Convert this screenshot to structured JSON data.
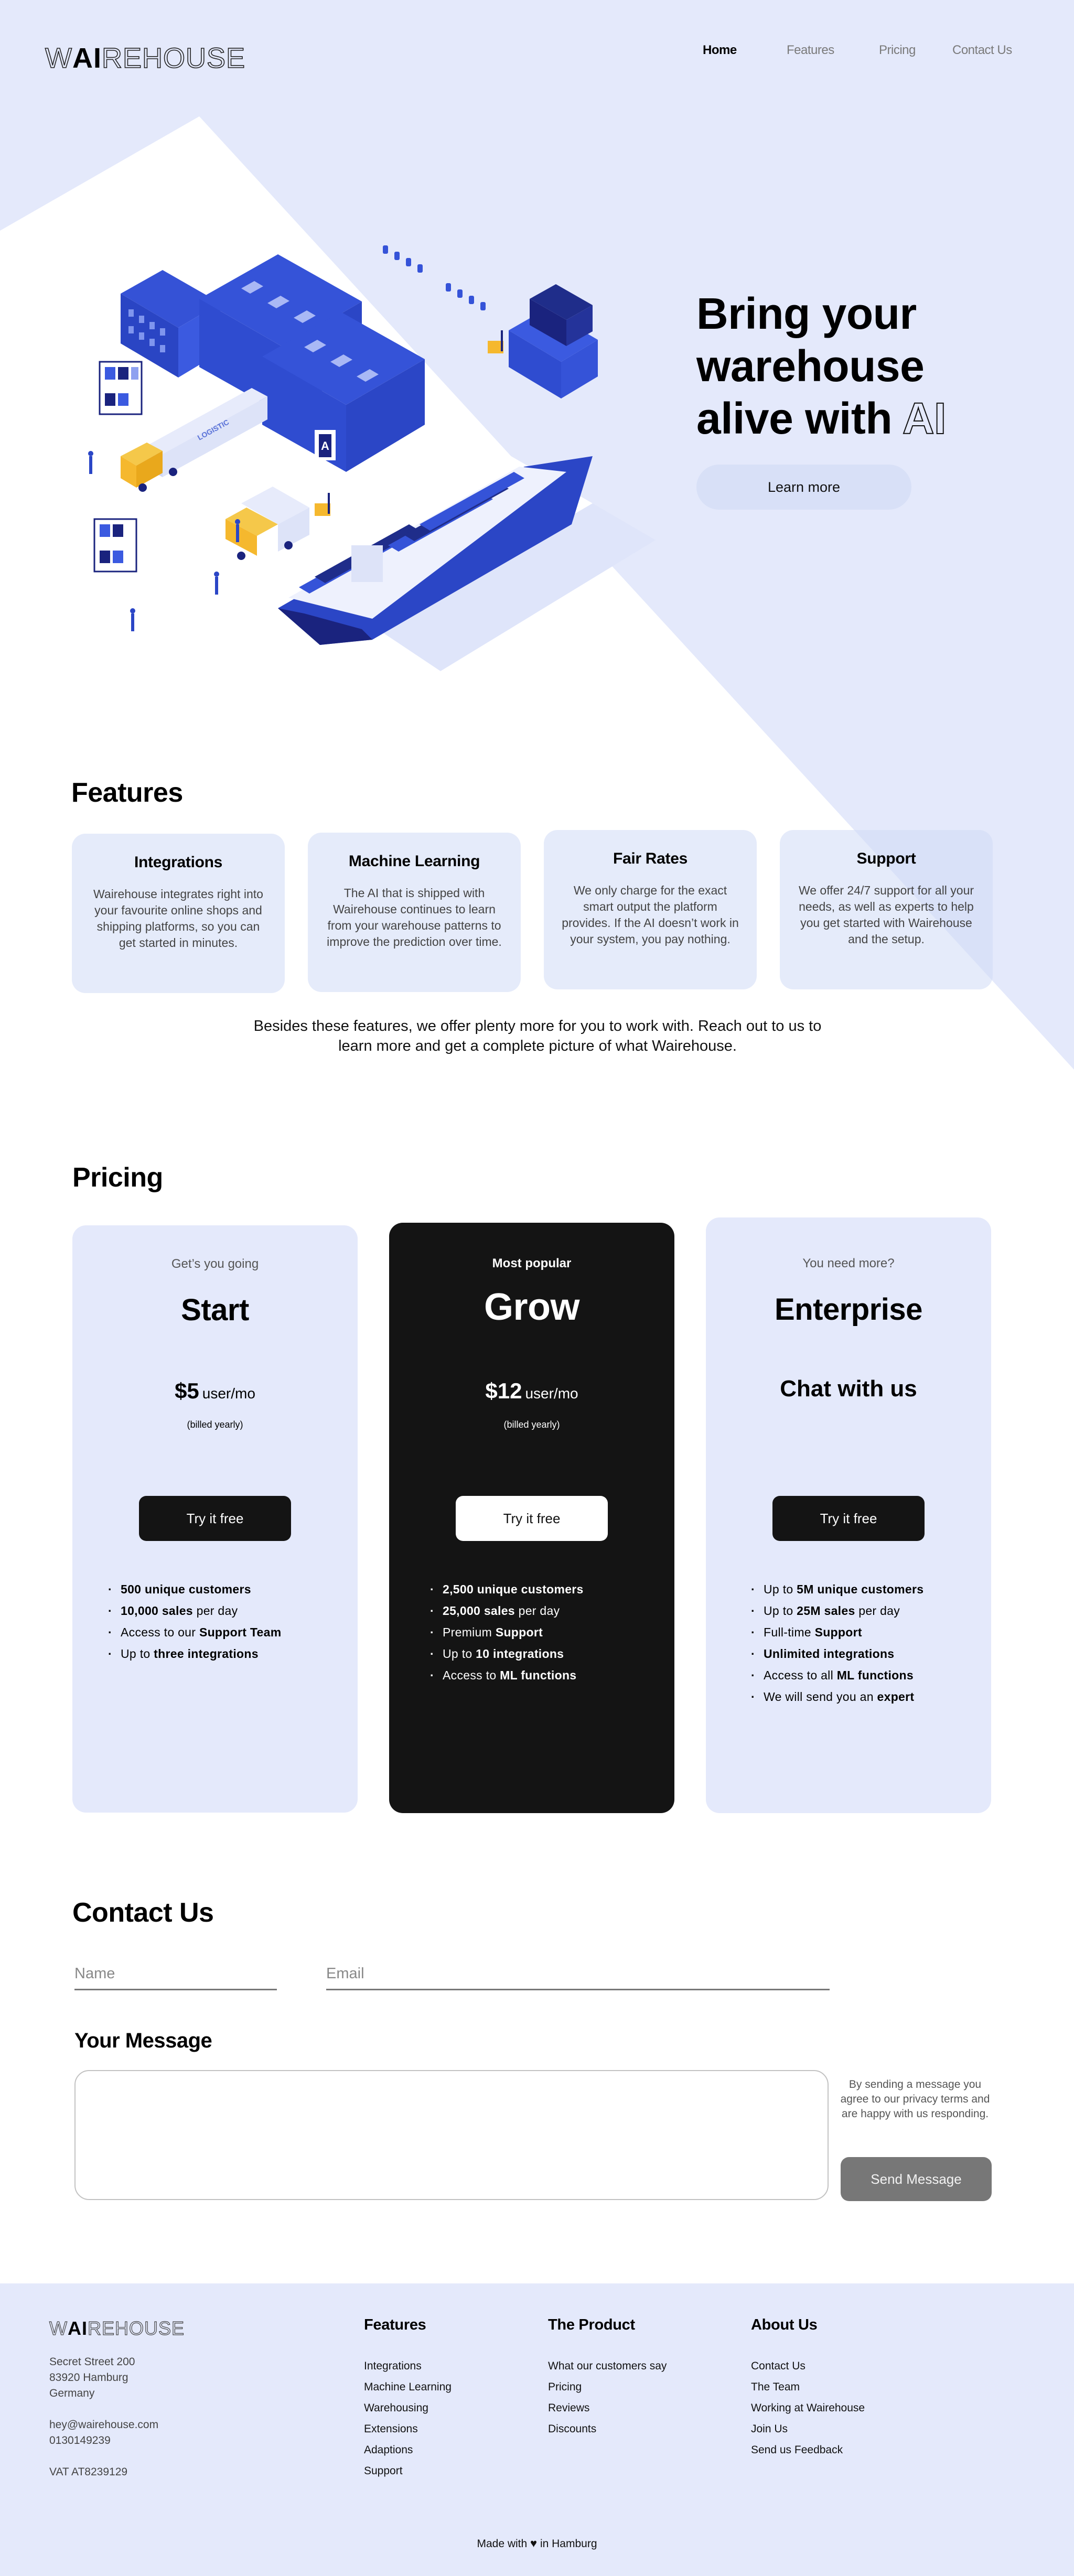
{
  "colors": {
    "background_tint": "#e4e9fb",
    "card_light": "#e4e9fb",
    "card_dark": "#141414",
    "learn_more_bg": "#d8e0f7",
    "illustration_blue": "#2f4fd0",
    "illustration_navy": "#1a237e",
    "illustration_yellow": "#f5b82e",
    "send_button": "#777777"
  },
  "header": {
    "logo": {
      "prefix": "W",
      "highlight": "AI",
      "suffix": "REHOUSE"
    },
    "nav": [
      {
        "label": "Home",
        "active": true
      },
      {
        "label": "Features",
        "active": false
      },
      {
        "label": "Pricing",
        "active": false
      },
      {
        "label": "Contact Us",
        "active": false
      }
    ]
  },
  "hero": {
    "title_line1": "Bring your",
    "title_line2": "warehouse",
    "title_line3_prefix": "alive with ",
    "title_line3_outline": "AI",
    "cta_label": "Learn more",
    "illustration": {
      "semantic": "isometric-warehouse-logistics-illustration",
      "truck_label": "LOGISTIC",
      "building_sign": "A"
    }
  },
  "features": {
    "title": "Features",
    "cards": [
      {
        "title": "Integrations",
        "text": "Wairehouse integrates right into your favourite online shops and shipping platforms, so you can get started in minutes."
      },
      {
        "title": "Machine Learning",
        "text": "The AI that is shipped with Wairehouse continues to learn from your warehouse patterns to improve the prediction over time."
      },
      {
        "title": "Fair Rates",
        "text": "We only charge for the exact smart output the platform provides. If the AI doesn’t work in your system, you pay nothing."
      },
      {
        "title": "Support",
        "text": "We offer 24/7 support for all your needs, as well as experts to help you get started with Wairehouse and the setup."
      }
    ],
    "outro": "Besides these features, we offer plenty more for you to work with. Reach out to us to learn more and get a complete picture of what Wairehouse."
  },
  "pricing": {
    "title": "Pricing",
    "plans": [
      {
        "tagline": "Get’s you going",
        "name": "Start",
        "price": "$5",
        "unit": "user/mo",
        "billing": "(billed yearly)",
        "cta": "Try it free",
        "features": [
          [
            {
              "b": "500 unique customers"
            }
          ],
          [
            {
              "b": "10,000 sales"
            },
            {
              "t": " per day"
            }
          ],
          [
            {
              "t": "Access to our "
            },
            {
              "b": "Support Team"
            }
          ],
          [
            {
              "t": "Up to "
            },
            {
              "b": "three integrations"
            }
          ]
        ]
      },
      {
        "tagline": "Most popular",
        "name": "Grow",
        "price": "$12",
        "unit": "user/mo",
        "billing": "(billed yearly)",
        "cta": "Try it free",
        "features": [
          [
            {
              "b": "2,500 unique customers"
            }
          ],
          [
            {
              "b": "25,000 sales"
            },
            {
              "t": " per day"
            }
          ],
          [
            {
              "t": "Premium "
            },
            {
              "b": "Support"
            }
          ],
          [
            {
              "t": "Up to "
            },
            {
              "b": "10 integrations"
            }
          ],
          [
            {
              "t": "Access to "
            },
            {
              "b": "ML functions"
            }
          ]
        ]
      },
      {
        "tagline": "You need more?",
        "name": "Enterprise",
        "price_text": "Chat with us",
        "cta": "Try it free",
        "features": [
          [
            {
              "t": "Up to "
            },
            {
              "b": "5M unique customers"
            }
          ],
          [
            {
              "t": "Up to "
            },
            {
              "b": "25M sales"
            },
            {
              "t": " per day"
            }
          ],
          [
            {
              "t": "Full-time "
            },
            {
              "b": "Support"
            }
          ],
          [
            {
              "b": "Unlimited integrations"
            }
          ],
          [
            {
              "t": "Access to all "
            },
            {
              "b": "ML functions"
            }
          ],
          [
            {
              "t": "We will send you an "
            },
            {
              "b": "expert"
            }
          ]
        ]
      }
    ]
  },
  "contact": {
    "title": "Contact Us",
    "name_placeholder": "Name",
    "name_value": "",
    "email_placeholder": "Email",
    "email_value": "",
    "message_title": "Your Message",
    "message_value": "",
    "privacy_note": "By sending a message you agree to our privacy terms and are happy with us responding.",
    "send_label": "Send Message"
  },
  "footer": {
    "logo": {
      "prefix": "W",
      "highlight": "AI",
      "suffix": "REHOUSE"
    },
    "address": [
      "Secret Street 200",
      "83920 Hamburg",
      "Germany"
    ],
    "contact": [
      "hey@wairehouse.com",
      "0130149239"
    ],
    "vat": "VAT AT8239129",
    "columns": [
      {
        "title": "Features",
        "links": [
          "Integrations",
          "Machine Learning",
          "Warehousing",
          "Extensions",
          "Adaptions",
          "Support"
        ]
      },
      {
        "title": "The Product",
        "links": [
          "What our customers say",
          "Pricing",
          "Reviews",
          "Discounts"
        ]
      },
      {
        "title": "About Us",
        "links": [
          "Contact Us",
          "The Team",
          "Working at Wairehouse",
          "Join Us",
          "Send us Feedback"
        ]
      }
    ],
    "made_with_prefix": "Made with",
    "made_with_icon": "heart-icon",
    "made_with_suffix": "in Hamburg"
  }
}
